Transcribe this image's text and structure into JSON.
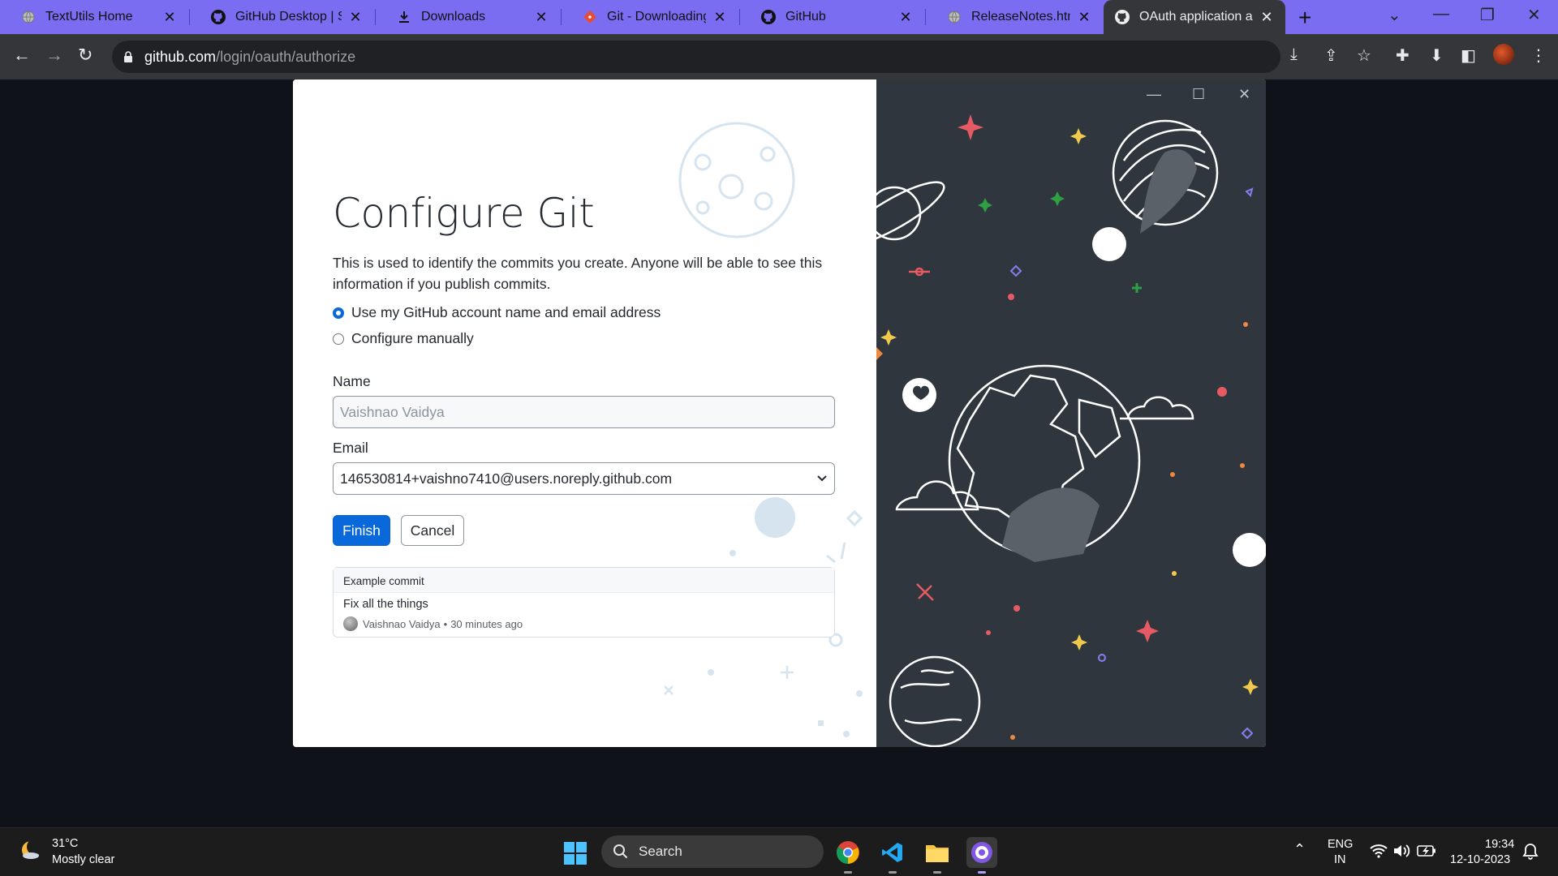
{
  "browser": {
    "tabs": [
      {
        "title": "TextUtils Home",
        "favicon": "globe-icon"
      },
      {
        "title": "GitHub Desktop | Sim",
        "favicon": "github-icon"
      },
      {
        "title": "Downloads",
        "favicon": "download-icon"
      },
      {
        "title": "Git - Downloading Pa",
        "favicon": "git-icon"
      },
      {
        "title": "GitHub",
        "favicon": "github-icon"
      },
      {
        "title": "ReleaseNotes.html",
        "favicon": "globe-icon"
      },
      {
        "title": "OAuth application au",
        "favicon": "github-icon",
        "active": true
      }
    ],
    "url_host": "github.com",
    "url_path": "/login/oauth/authorize"
  },
  "dialog": {
    "title": "Configure Git",
    "description": "This is used to identify the commits you create. Anyone will be able to see this information if you publish commits.",
    "option_account": "Use my GitHub account name and email address",
    "option_manual": "Configure manually",
    "selected_option": "account",
    "name_label": "Name",
    "name_value": "Vaishnao Vaidya",
    "email_label": "Email",
    "email_value": "146530814+vaishno7410@users.noreply.github.com",
    "finish_label": "Finish",
    "cancel_label": "Cancel",
    "example": {
      "header": "Example commit",
      "message": "Fix all the things",
      "author": "Vaishnao Vaidya",
      "separator": "•",
      "time": "30 minutes ago"
    }
  },
  "taskbar": {
    "weather_temp": "31°C",
    "weather_desc": "Mostly clear",
    "search_label": "Search",
    "language_top": "ENG",
    "language_bottom": "IN",
    "time": "19:34",
    "date": "12-10-2023"
  },
  "colors": {
    "tabstrip": "#7b6df2",
    "primary_button": "#0969da",
    "illustration_bg": "#2f363d"
  }
}
